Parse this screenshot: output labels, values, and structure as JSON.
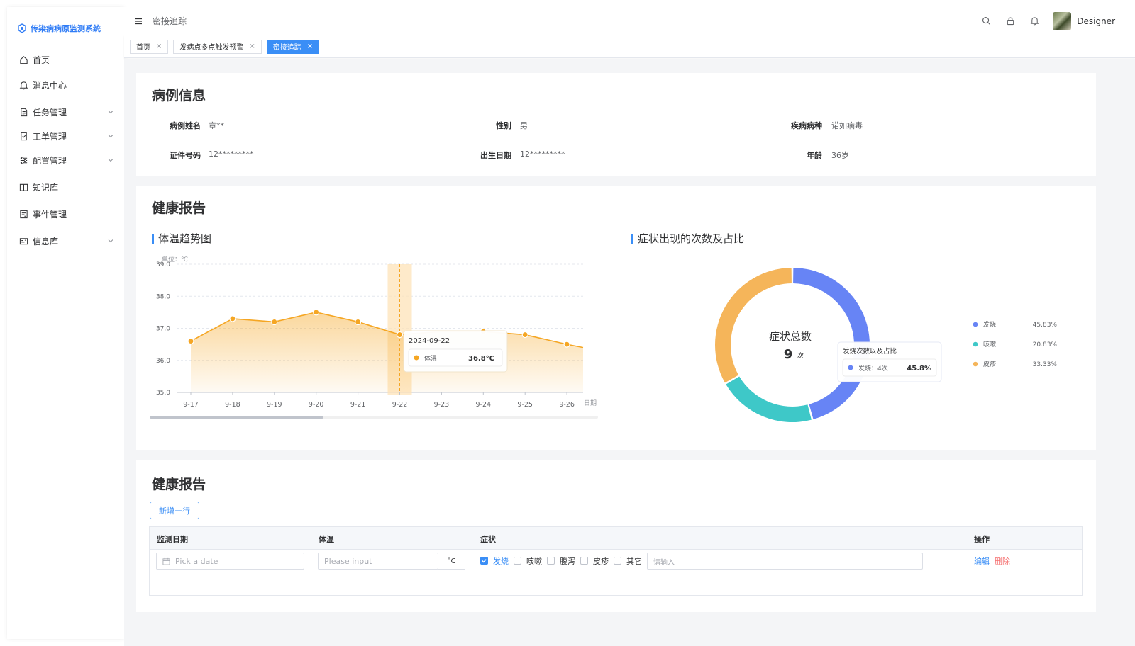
{
  "app": {
    "title": "传染病病原监测系统"
  },
  "sidebar": {
    "items": [
      {
        "label": "首页",
        "icon": "home-icon",
        "expandable": false
      },
      {
        "label": "消息中心",
        "icon": "bell-icon",
        "expandable": false
      },
      {
        "label": "任务管理",
        "icon": "document-icon",
        "expandable": true
      },
      {
        "label": "工单管理",
        "icon": "edit-document-icon",
        "expandable": true
      },
      {
        "label": "配置管理",
        "icon": "sliders-icon",
        "expandable": true
      },
      {
        "label": "知识库",
        "icon": "book-icon",
        "expandable": false
      },
      {
        "label": "事件管理",
        "icon": "event-icon",
        "expandable": false
      },
      {
        "label": "信息库",
        "icon": "info-card-icon",
        "expandable": true
      }
    ]
  },
  "header": {
    "breadcrumb": "密接追踪",
    "username": "Designer"
  },
  "tabs": [
    {
      "label": "首页",
      "active": false
    },
    {
      "label": "发病点多点触发预警",
      "active": false
    },
    {
      "label": "密接追踪",
      "active": true
    }
  ],
  "case_info": {
    "title": "病例信息",
    "fields": [
      {
        "label": "病例姓名",
        "value": "章**"
      },
      {
        "label": "性别",
        "value": "男"
      },
      {
        "label": "疾病病种",
        "value": "诺如病毒"
      },
      {
        "label": "证件号码",
        "value": "12*********"
      },
      {
        "label": "出生日期",
        "value": "12*********"
      },
      {
        "label": "年龄",
        "value": "36岁"
      }
    ]
  },
  "health_report": {
    "title": "健康报告",
    "temp_chart_title": "体温趋势图",
    "symptom_chart_title": "症状出现的次数及占比"
  },
  "chart_data": [
    {
      "type": "area",
      "title": "体温趋势图",
      "unit_label": "单位：℃",
      "xlabel": "日期",
      "categories": [
        "9-17",
        "9-18",
        "9-19",
        "9-20",
        "9-21",
        "9-22",
        "9-23",
        "9-24",
        "9-25",
        "9-26"
      ],
      "series": [
        {
          "name": "体温",
          "values": [
            36.6,
            37.3,
            37.2,
            37.5,
            37.2,
            36.8,
            36.9,
            36.9,
            36.8,
            36.5
          ]
        }
      ],
      "extra_tail_value": 36.4,
      "yticks": [
        "39.0",
        "38.0",
        "37.0",
        "36.0",
        "35.0"
      ],
      "ylim": [
        35.0,
        39.0
      ],
      "grid": true,
      "color": "#f5a623",
      "tooltip": {
        "date": "2024-09-22",
        "series": "体温",
        "value": "36.8°C",
        "index": 5
      }
    },
    {
      "type": "pie",
      "title": "症状出现的次数及占比",
      "center_label": "症状总数",
      "center_value": "9",
      "center_unit": "次",
      "slices": [
        {
          "name": "发烧",
          "percent": "45.83%",
          "value": 45.83,
          "color": "#6784f5"
        },
        {
          "name": "咳嗽",
          "percent": "20.83%",
          "value": 20.83,
          "color": "#3ec8c8"
        },
        {
          "name": "皮疹",
          "percent": "33.33%",
          "value": 33.33,
          "color": "#f5b55a"
        }
      ],
      "legend_position": "right",
      "tooltip": {
        "title": "发烧次数以及占比",
        "label": "发烧：4次",
        "value": "45.8%"
      }
    }
  ],
  "report_table": {
    "title": "健康报告",
    "add_label": "新增一行",
    "columns": [
      "监测日期",
      "体温",
      "症状",
      "操作"
    ],
    "date_placeholder": "Pick a date",
    "temp_placeholder": "Please input",
    "temp_unit": "°C",
    "symptoms": [
      {
        "label": "发烧",
        "checked": true
      },
      {
        "label": "咳嗽",
        "checked": false
      },
      {
        "label": "腹泻",
        "checked": false
      },
      {
        "label": "皮疹",
        "checked": false
      },
      {
        "label": "其它",
        "checked": false
      }
    ],
    "other_placeholder": "请输入",
    "edit_label": "编辑",
    "delete_label": "删除"
  },
  "colors": {
    "accent": "#3a8ef6",
    "chart_line": "#f5a623",
    "danger": "#f56c6c"
  }
}
